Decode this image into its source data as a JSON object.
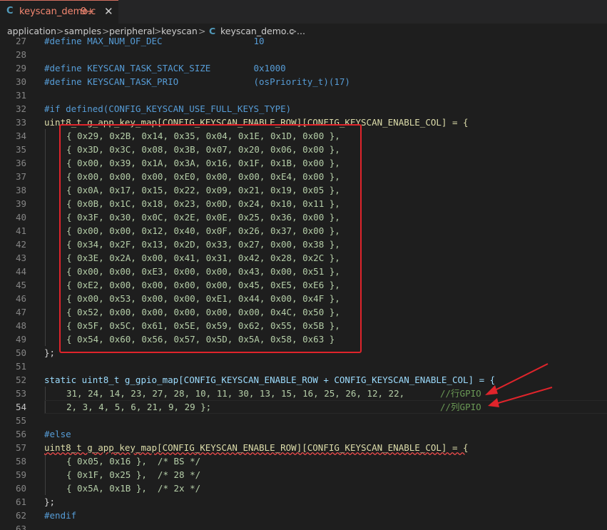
{
  "tab": {
    "icon": "C",
    "filename": "keyscan_demo.c",
    "badge": "9+",
    "close": "✕"
  },
  "breadcrumb": {
    "items": [
      "application",
      "samples",
      "peripheral",
      "keyscan",
      "keyscan_demo.c",
      "..."
    ],
    "separator": ">",
    "file_icon": "C"
  },
  "editor": {
    "current_line": 54,
    "lines": [
      {
        "n": "27",
        "text": "#define MAX_NUM_OF_DEC                 10"
      },
      {
        "n": "28",
        "text": ""
      },
      {
        "n": "29",
        "text": "#define KEYSCAN_TASK_STACK_SIZE        0x1000"
      },
      {
        "n": "30",
        "text": "#define KEYSCAN_TASK_PRIO              (osPriority_t)(17)"
      },
      {
        "n": "31",
        "text": ""
      },
      {
        "n": "32",
        "text": "#if defined(CONFIG_KEYSCAN_USE_FULL_KEYS_TYPE)"
      },
      {
        "n": "33",
        "text": "uint8_t g_app_key_map[CONFIG_KEYSCAN_ENABLE_ROW][CONFIG_KEYSCAN_ENABLE_COL] = {"
      },
      {
        "n": "34",
        "text": "{ 0x29, 0x2B, 0x14, 0x35, 0x04, 0x1E, 0x1D, 0x00 },"
      },
      {
        "n": "35",
        "text": "{ 0x3D, 0x3C, 0x08, 0x3B, 0x07, 0x20, 0x06, 0x00 },"
      },
      {
        "n": "36",
        "text": "{ 0x00, 0x39, 0x1A, 0x3A, 0x16, 0x1F, 0x1B, 0x00 },"
      },
      {
        "n": "37",
        "text": "{ 0x00, 0x00, 0x00, 0xE0, 0x00, 0x00, 0xE4, 0x00 },"
      },
      {
        "n": "38",
        "text": "{ 0x0A, 0x17, 0x15, 0x22, 0x09, 0x21, 0x19, 0x05 },"
      },
      {
        "n": "39",
        "text": "{ 0x0B, 0x1C, 0x18, 0x23, 0x0D, 0x24, 0x10, 0x11 },"
      },
      {
        "n": "40",
        "text": "{ 0x3F, 0x30, 0x0C, 0x2E, 0x0E, 0x25, 0x36, 0x00 },"
      },
      {
        "n": "41",
        "text": "{ 0x00, 0x00, 0x12, 0x40, 0x0F, 0x26, 0x37, 0x00 },"
      },
      {
        "n": "42",
        "text": "{ 0x34, 0x2F, 0x13, 0x2D, 0x33, 0x27, 0x00, 0x38 },"
      },
      {
        "n": "43",
        "text": "{ 0x3E, 0x2A, 0x00, 0x41, 0x31, 0x42, 0x28, 0x2C },"
      },
      {
        "n": "44",
        "text": "{ 0x00, 0x00, 0xE3, 0x00, 0x00, 0x43, 0x00, 0x51 },"
      },
      {
        "n": "45",
        "text": "{ 0xE2, 0x00, 0x00, 0x00, 0x00, 0x45, 0xE5, 0xE6 },"
      },
      {
        "n": "46",
        "text": "{ 0x00, 0x53, 0x00, 0x00, 0xE1, 0x44, 0x00, 0x4F },"
      },
      {
        "n": "47",
        "text": "{ 0x52, 0x00, 0x00, 0x00, 0x00, 0x00, 0x4C, 0x50 },"
      },
      {
        "n": "48",
        "text": "{ 0x5F, 0x5C, 0x61, 0x5E, 0x59, 0x62, 0x55, 0x5B },"
      },
      {
        "n": "49",
        "text": "{ 0x54, 0x60, 0x56, 0x57, 0x5D, 0x5A, 0x58, 0x63 }"
      },
      {
        "n": "50",
        "text": "};"
      },
      {
        "n": "51",
        "text": ""
      },
      {
        "n": "52",
        "text": "static uint8_t g_gpio_map[CONFIG_KEYSCAN_ENABLE_ROW + CONFIG_KEYSCAN_ENABLE_COL] = {"
      },
      {
        "n": "53",
        "text": "31, 24, 14, 23, 27, 28, 10, 11, 30, 13, 15, 16, 25, 26, 12, 22,",
        "comment": "//行GPIO"
      },
      {
        "n": "54",
        "text": "2, 3, 4, 5, 6, 21, 9, 29 };",
        "comment": "//列GPIO"
      },
      {
        "n": "55",
        "text": ""
      },
      {
        "n": "56",
        "text": "#else"
      },
      {
        "n": "57",
        "text": "uint8_t g_app_key_map[CONFIG_KEYSCAN_ENABLE_ROW][CONFIG_KEYSCAN_ENABLE_COL] = {"
      },
      {
        "n": "58",
        "text": "{ 0x05, 0x16 },  /* BS */"
      },
      {
        "n": "59",
        "text": "{ 0x1F, 0x25 },  /* 28 */"
      },
      {
        "n": "60",
        "text": "{ 0x5A, 0x1B },  /* 2x */"
      },
      {
        "n": "61",
        "text": "};"
      },
      {
        "n": "62",
        "text": "#endif"
      },
      {
        "n": "63",
        "text": ""
      }
    ]
  },
  "colors": {
    "background": "#1e1e1e",
    "annotation_red": "#e0242b",
    "error_tab": "#f48771"
  }
}
